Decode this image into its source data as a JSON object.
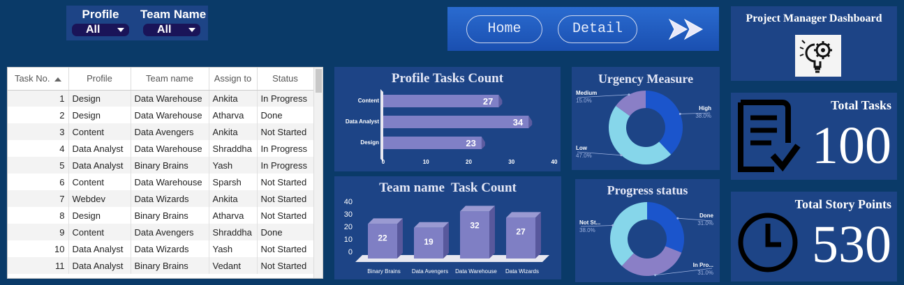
{
  "filters": [
    {
      "label": "Profile",
      "value": "All"
    },
    {
      "label": "Team Name",
      "value": "All"
    }
  ],
  "nav": {
    "home_label": "Home",
    "detail_label": "Detail"
  },
  "table": {
    "columns": [
      "Task No.",
      "Profile",
      "Team name",
      "Assign to",
      "Status"
    ],
    "rows": [
      [
        "1",
        "Design",
        "Data Warehouse",
        "Ankita",
        "In Progress"
      ],
      [
        "2",
        "Design",
        "Data Warehouse",
        "Atharva",
        "Done"
      ],
      [
        "3",
        "Content",
        "Data Avengers",
        "Ankita",
        "Not Started"
      ],
      [
        "4",
        "Data Analyst",
        "Data Warehouse",
        "Shraddha",
        "In Progress"
      ],
      [
        "5",
        "Data Analyst",
        "Binary Brains",
        "Yash",
        "In Progress"
      ],
      [
        "6",
        "Content",
        "Data Warehouse",
        "Sparsh",
        "Not Started"
      ],
      [
        "7",
        "Webdev",
        "Data Wizards",
        "Ankita",
        "Not Started"
      ],
      [
        "8",
        "Design",
        "Binary Brains",
        "Atharva",
        "Not Started"
      ],
      [
        "9",
        "Content",
        "Data Avengers",
        "Shraddha",
        "Done"
      ],
      [
        "10",
        "Data Analyst",
        "Data Wizards",
        "Yash",
        "Not Started"
      ],
      [
        "11",
        "Data Analyst",
        "Binary Brains",
        "Vedant",
        "Not Started"
      ]
    ]
  },
  "cards": {
    "dashboard_title": "Project Manager Dashboard",
    "total_tasks_label": "Total Tasks",
    "total_tasks_value": "100",
    "total_story_points_label": "Total Story Points",
    "total_story_points_value": "530"
  },
  "colors": {
    "background": "#0a3a68",
    "panel": "#1d4486",
    "bar": "#7f7fc4",
    "donut_dark": "#1b55cc",
    "donut_light": "#86d6ea",
    "donut_purple": "#8a7fc6"
  },
  "chart_data": [
    {
      "type": "bar",
      "orientation": "horizontal",
      "title": "Profile Tasks Count",
      "categories": [
        "Content",
        "Data Analyst",
        "Design"
      ],
      "values": [
        27,
        34,
        23
      ],
      "xlim": [
        0,
        40
      ],
      "ticks": [
        0,
        10,
        20,
        30,
        40
      ]
    },
    {
      "type": "pie",
      "donut": true,
      "title": "Urgency Measure",
      "slices": [
        {
          "label": "High",
          "value": 38.0,
          "pct": "38.0%",
          "color": "#1b55cc"
        },
        {
          "label": "Low",
          "value": 47.0,
          "pct": "47.0%",
          "color": "#86d6ea"
        },
        {
          "label": "Medium",
          "value": 15.0,
          "pct": "15.0%",
          "color": "#8a7fc6"
        }
      ]
    },
    {
      "type": "bar",
      "title": "Team name  Task Count",
      "categories": [
        "Binary Brains",
        "Data Avengers",
        "Data Warehouse",
        "Data Wizards"
      ],
      "values": [
        22,
        19,
        32,
        27
      ],
      "ylim": [
        0,
        40
      ],
      "ticks": [
        0,
        10,
        20,
        30,
        40
      ]
    },
    {
      "type": "pie",
      "donut": true,
      "title": "Progress status",
      "slices": [
        {
          "label": "Done",
          "value": 31.0,
          "pct": "31.0%",
          "color": "#1b55cc"
        },
        {
          "label": "In Pro...",
          "value": 31.0,
          "pct": "31.0%",
          "color": "#8a7fc6"
        },
        {
          "label": "Not St...",
          "value": 38.0,
          "pct": "38.0%",
          "color": "#86d6ea"
        }
      ]
    }
  ]
}
